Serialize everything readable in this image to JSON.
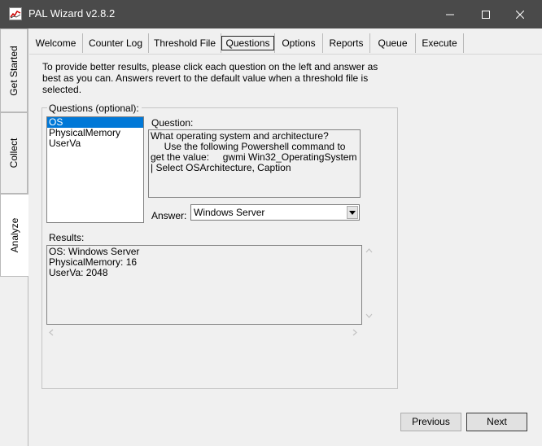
{
  "window": {
    "title": "PAL Wizard v2.8.2",
    "controls": [
      "minimize-icon",
      "maximize-icon",
      "close-icon"
    ]
  },
  "side_tabs": [
    {
      "label": "Get Started"
    },
    {
      "label": "Collect"
    },
    {
      "label": "Analyze",
      "active": true
    }
  ],
  "tabs": [
    {
      "label": "Welcome"
    },
    {
      "label": "Counter Log"
    },
    {
      "label": "Threshold File"
    },
    {
      "label": "Questions",
      "active": true
    },
    {
      "label": "Options"
    },
    {
      "label": "Reports"
    },
    {
      "label": "Queue"
    },
    {
      "label": "Execute"
    }
  ],
  "instructions": "To provide better results, please click each question on the left and answer as best as you can. Answers revert to the default value when a threshold file is selected.",
  "questions_group": {
    "legend": "Questions (optional):",
    "items": [
      {
        "label": "OS",
        "selected": true
      },
      {
        "label": "PhysicalMemory"
      },
      {
        "label": "UserVa"
      }
    ]
  },
  "question": {
    "label": "Question:",
    "text": "What operating system and architecture?\n     Use the following Powershell command to get the value:     gwmi Win32_OperatingSystem | Select OSArchitecture, Caption"
  },
  "answer": {
    "label": "Answer:",
    "value": "Windows Server"
  },
  "results": {
    "label": "Results:",
    "lines": [
      "OS: Windows Server",
      "PhysicalMemory: 16",
      "UserVa: 2048"
    ]
  },
  "buttons": {
    "previous": "Previous",
    "next": "Next"
  },
  "colors": {
    "titlebar": "#4a4a4a",
    "selection": "#0078d7",
    "background": "#f0f0f0"
  }
}
